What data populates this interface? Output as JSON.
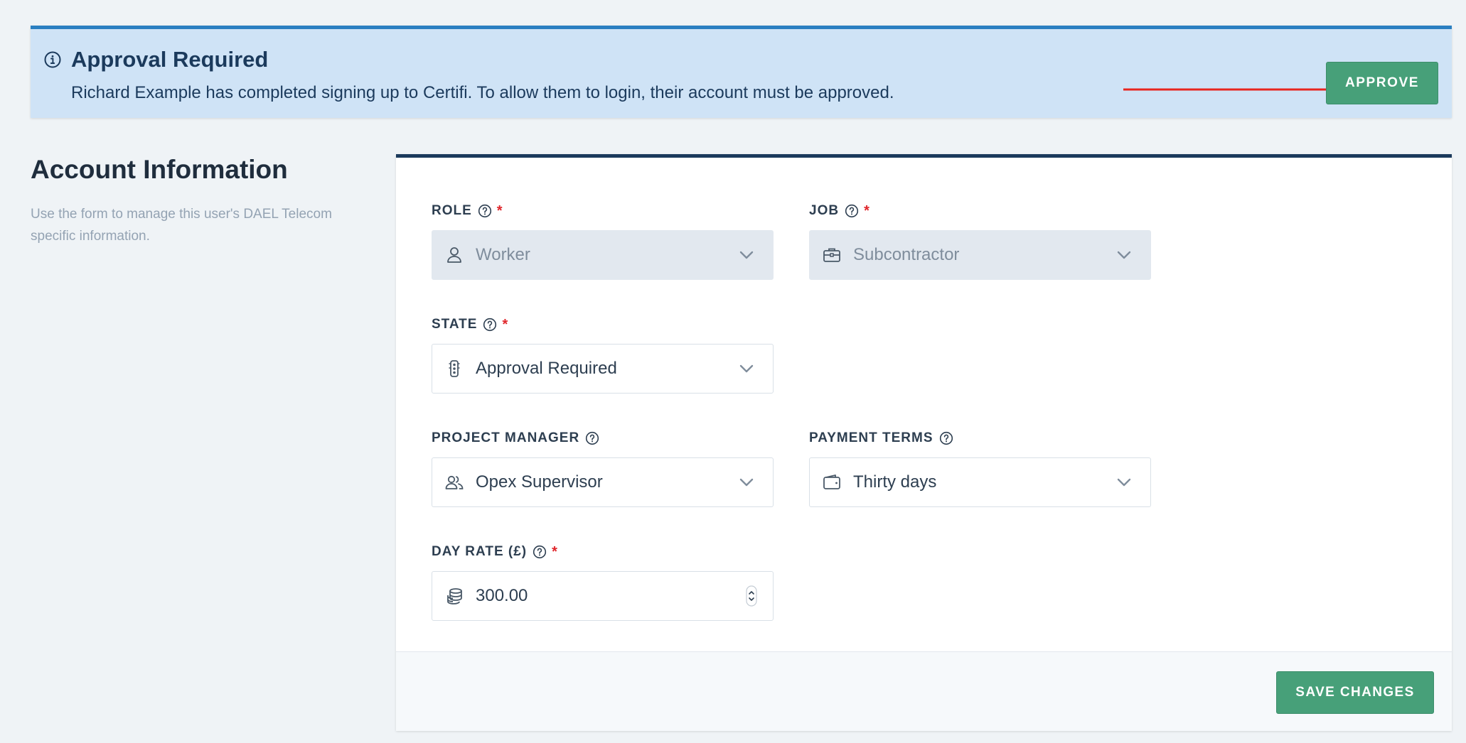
{
  "banner": {
    "title": "Approval Required",
    "message": "Richard Example has completed signing up to Certifi. To allow them to login, their account must be approved.",
    "approve_label": "APPROVE",
    "bg_color": "#cfe3f6",
    "accent_color": "#2a7fc1",
    "arrow_color": "#e8261f"
  },
  "section": {
    "title": "Account Information",
    "description": "Use the form to manage this user's DAEL Telecom specific information."
  },
  "form": {
    "role": {
      "label": "ROLE",
      "value": "Worker",
      "required": true,
      "disabled": true,
      "icon": "user-icon"
    },
    "job": {
      "label": "JOB",
      "value": "Subcontractor",
      "required": true,
      "disabled": true,
      "icon": "briefcase-icon"
    },
    "state": {
      "label": "STATE",
      "value": "Approval Required",
      "required": true,
      "icon": "traffic-light-icon"
    },
    "project_manager": {
      "label": "PROJECT MANAGER",
      "value": "Opex Supervisor",
      "required": false,
      "icon": "users-icon"
    },
    "payment_terms": {
      "label": "PAYMENT TERMS",
      "value": "Thirty days",
      "required": false,
      "icon": "wallet-icon"
    },
    "day_rate": {
      "label": "DAY RATE (£)",
      "value": "300.00",
      "required": true,
      "icon": "coins-icon"
    },
    "required_marker": "*"
  },
  "footer": {
    "save_label": "SAVE CHANGES",
    "button_color": "#47a079"
  }
}
